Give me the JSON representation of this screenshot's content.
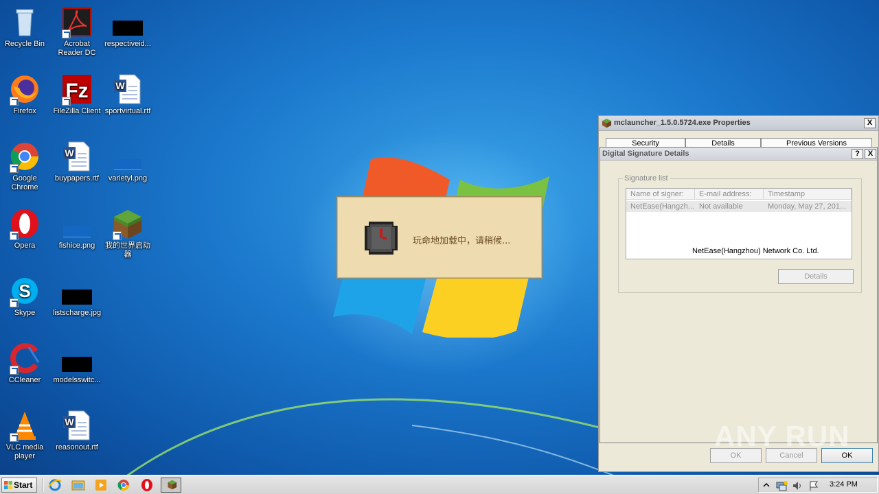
{
  "desktop": {
    "icons": [
      {
        "label": "Recycle Bin"
      },
      {
        "label": "Acrobat Reader DC"
      },
      {
        "label": "respectiveid..."
      },
      {
        "label": "Firefox"
      },
      {
        "label": "FileZilla Client"
      },
      {
        "label": "sportvirtual.rtf"
      },
      {
        "label": "Google Chrome"
      },
      {
        "label": "buypapers.rtf"
      },
      {
        "label": "varietyl.png"
      },
      {
        "label": "Opera"
      },
      {
        "label": "fishice.png"
      },
      {
        "label": "我的世界启动器"
      },
      {
        "label": "Skype"
      },
      {
        "label": "listscharge.jpg"
      },
      {
        "label": "CCleaner"
      },
      {
        "label": "modelsswitc..."
      },
      {
        "label": "VLC media player"
      },
      {
        "label": "reasonout.rtf"
      }
    ]
  },
  "loader": {
    "message": "玩命地加载中，请稍候..."
  },
  "properties_window": {
    "title": "mclauncher_1.5.0.5724.exe Properties",
    "close": "X",
    "tabs": [
      "Security",
      "Details",
      "Previous Versions"
    ],
    "buttons": {
      "ok": "OK",
      "cancel": "Cancel",
      "ok_active": "OK"
    }
  },
  "signature_details": {
    "title": "Digital Signature Details",
    "help": "?",
    "close": "X",
    "group_label": "Signature list",
    "columns": [
      "Name of signer:",
      "E-mail address:",
      "Timestamp"
    ],
    "rows": [
      {
        "name": "NetEase(Hangzh...",
        "email": "Not available",
        "timestamp": "Monday, May 27, 201..."
      }
    ],
    "tooltip": "NetEase(Hangzhou) Network Co. Ltd.",
    "details_button": "Details"
  },
  "watermark": "ANY RUN",
  "taskbar": {
    "start_label": "Start",
    "clock": "3:24 PM"
  },
  "colors": {
    "desktop_blue": "#1b78cc",
    "loader_bg": "#eedcb0",
    "loader_text": "#6b4c24",
    "window_bg": "#ece9d8"
  }
}
